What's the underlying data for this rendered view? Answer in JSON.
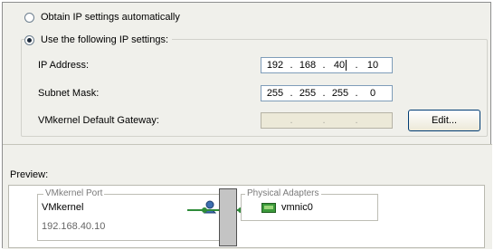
{
  "ip_settings": {
    "auto_label": "Obtain IP settings automatically",
    "manual_label": "Use the following IP settings:",
    "ip_address": {
      "label": "IP Address:",
      "octets": [
        "192",
        "168",
        "40",
        "10"
      ]
    },
    "subnet_mask": {
      "label": "Subnet Mask:",
      "octets": [
        "255",
        "255",
        "255",
        "0"
      ]
    },
    "gateway": {
      "label": "VMkernel Default Gateway:",
      "octets": [
        "",
        "",
        "",
        ""
      ]
    },
    "edit_label": "Edit..."
  },
  "preview": {
    "label": "Preview:",
    "port_group_legend": "VMkernel Port",
    "port_name": "VMkernel",
    "port_ip": "192.168.40.10",
    "adapters_legend": "Physical Adapters",
    "adapter_name": "vmnic0"
  },
  "colors": {
    "link_green": "#2f8c3a",
    "input_border": "#7f9db9"
  },
  "icons": {
    "vmkernel": "vmkernel-user-icon",
    "nic": "physical-nic-icon"
  }
}
